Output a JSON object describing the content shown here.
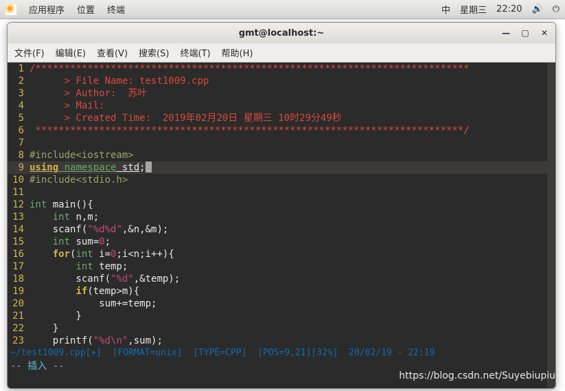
{
  "panel": {
    "apps": "应用程序",
    "places": "位置",
    "terminal": "终端",
    "im": "中",
    "day": "星期三",
    "time": "22:20"
  },
  "window": {
    "title": "gmt@localhost:~"
  },
  "menu": {
    "file": "文件(F)",
    "edit": "编辑(E)",
    "view": "查看(V)",
    "search": "搜索(S)",
    "terminal": "终端(T)",
    "help": "帮助(H)"
  },
  "code": {
    "l1": "/***************************************************************************",
    "l2a": "      > File Name: ",
    "l2b": "test1009.cpp",
    "l3a": "      > Author:  ",
    "l3b": "苏叶",
    "l4": "      > Mail:",
    "l5a": "      > Created Time:  ",
    "l5b": "2019年02月20日 星期三 10时29分49秒",
    "l6": " **************************************************************************/",
    "l7": "",
    "l8": "#include<iostream>",
    "l9a": "using",
    "l9b": " namespace",
    "l9c": " std",
    "l9d": ";",
    "l10": "#include<stdio.h>",
    "l11": "",
    "l12a": "int ",
    "l12b": "main(){",
    "l13a": "    ",
    "l13b": "int ",
    "l13c": "n,m;",
    "l14a": "    scanf(",
    "l14b": "\"%d%d\"",
    "l14c": ",&n,&m);",
    "l15a": "    ",
    "l15b": "int ",
    "l15c": "sum=",
    "l15d": "0",
    "l15e": ";",
    "l16a": "    ",
    "l16b": "for",
    "l16c": "(",
    "l16d": "int ",
    "l16e": "i=",
    "l16f": "0",
    "l16g": ";i<n;i++){",
    "l17a": "        ",
    "l17b": "int ",
    "l17c": "temp;",
    "l18a": "        scanf(",
    "l18b": "\"%d\"",
    "l18c": ",&temp);",
    "l19a": "        ",
    "l19b": "if",
    "l19c": "(temp>m){",
    "l20": "            sum+=temp;",
    "l21": "        }",
    "l22": "    }",
    "l23a": "    printf(",
    "l23b": "\"%d\\n\"",
    "l23c": ",sum);"
  },
  "status": {
    "file": "~/test1009.cpp",
    "mod": "[+]",
    "format": "[FORMAT=unix]",
    "type": "[TYPE=CPP]",
    "pos": "[POS=9,21]",
    "pct": "[32%]",
    "date": "20/02/19 - 22:19"
  },
  "mode": "-- 插入 --",
  "watermark": "https://blog.csdn.net/Suyebiupiu"
}
